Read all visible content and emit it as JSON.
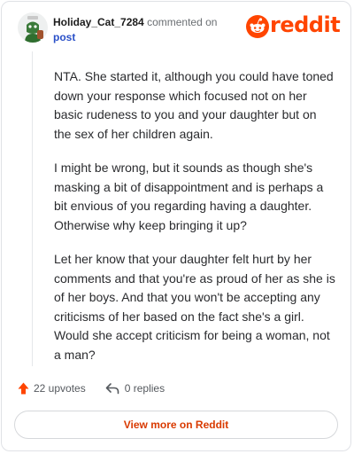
{
  "header": {
    "username": "Holiday_Cat_7284",
    "commented_text": "commented on",
    "post_link": "post",
    "brand": "reddit",
    "brand_color": "#ff4500"
  },
  "comment": {
    "paragraphs": [
      "NTA. She started it, although you could have toned down your response which focused not on her basic rudeness to you and your daughter but on the sex of her children again.",
      "I might be wrong, but it sounds as though she's masking a bit of disappointment and is perhaps a bit envious of you regarding having a daughter. Otherwise why keep bringing it up?",
      "Let her know that your daughter felt hurt by her comments and that you're as proud of her as she is of her boys. And that you won't be accepting any criticisms of her based on the fact she's a girl. Would she accept criticism for being a woman, not a man?"
    ]
  },
  "actions": {
    "upvotes": "22 upvotes",
    "replies": "0 replies"
  },
  "footer": {
    "view_more": "View more on Reddit"
  },
  "icons": {
    "avatar": "avatar-icon",
    "upvote": "upvote-arrow-icon",
    "reply": "reply-arrow-icon",
    "logo": "reddit-alien-icon"
  }
}
